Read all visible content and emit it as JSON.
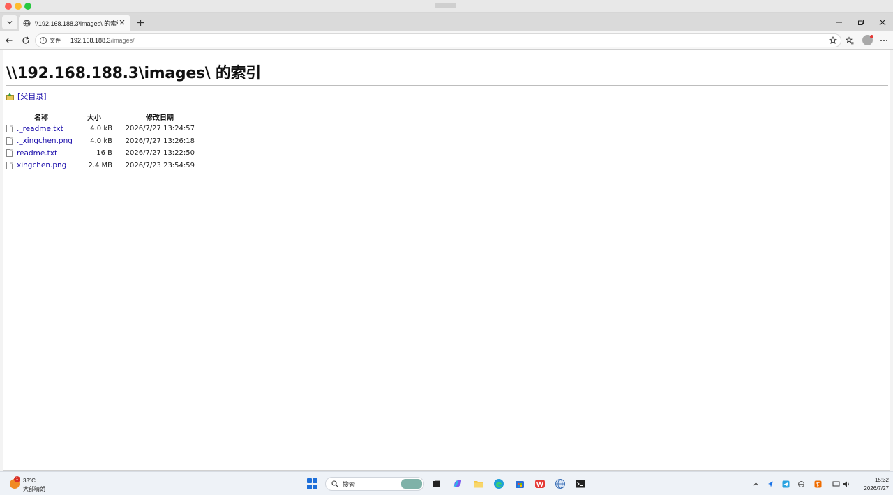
{
  "browser": {
    "tab_title": "\\\\192.168.188.3\\images\\ 的索引",
    "address_chip": "文件",
    "address_host": "192.168.188.3",
    "address_path": "/images/",
    "icons": {
      "tab_menu": "chevron-down-icon",
      "tab_favicon": "globe-icon",
      "tab_close": "close-icon",
      "new_tab": "plus-icon",
      "back": "back-arrow-icon",
      "reload": "reload-icon",
      "site_info": "info-icon",
      "favorite": "star-icon",
      "favorites_list": "favorites-icon",
      "profile": "avatar",
      "menu": "more-icon"
    }
  },
  "page": {
    "heading": "\\\\192.168.188.3\\images\\ 的索引",
    "parent_link": "[父目录]",
    "columns": {
      "name": "名称",
      "size": "大小",
      "date": "修改日期"
    },
    "files": [
      {
        "name": "._readme.txt",
        "size": "4.0 kB",
        "date": "2026/7/27 13:24:57"
      },
      {
        "name": "._xingchen.png",
        "size": "4.0 kB",
        "date": "2026/7/27 13:26:18"
      },
      {
        "name": "readme.txt",
        "size": "16 B",
        "date": "2026/7/27 13:22:50"
      },
      {
        "name": "xingchen.png",
        "size": "2.4 MB",
        "date": "2026/7/23 23:54:59"
      }
    ],
    "link_color": "#1a0dab"
  },
  "taskbar": {
    "weather_temp": "33°C",
    "weather_desc": "大部晴朗",
    "weather_badge": "1",
    "search_placeholder": "搜索",
    "time": "15:32",
    "date": "2026/7/27",
    "accent_color": "#1e6fd9"
  }
}
